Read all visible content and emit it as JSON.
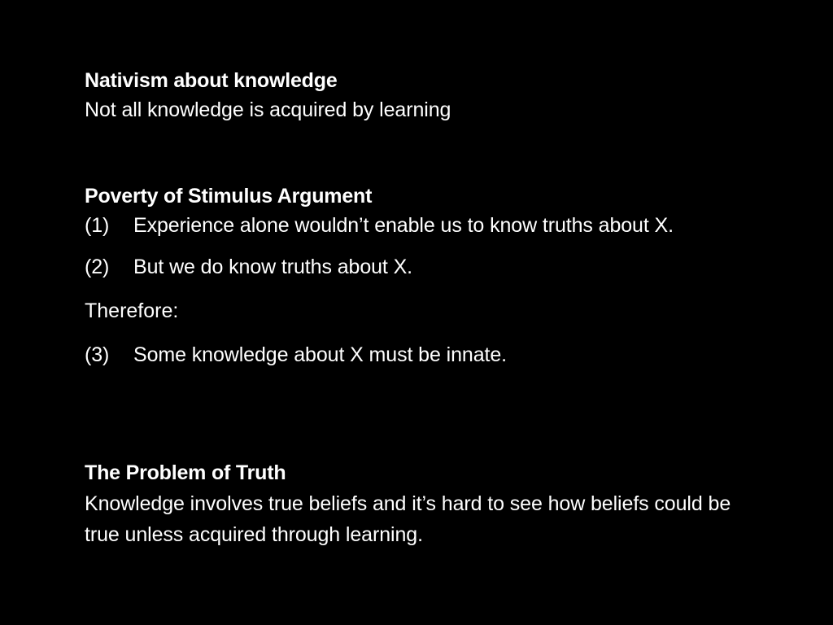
{
  "slide": {
    "background_color": "#000000",
    "text_color": "#ffffff",
    "nativism": {
      "heading": "Nativism about knowledge",
      "text": "Not all knowledge is acquired by learning"
    },
    "poverty": {
      "heading": "Poverty of Stimulus Argument",
      "items": [
        {
          "num": "(1)",
          "text": "Experience alone wouldn’t enable us to know truths about X."
        },
        {
          "num": "(2)",
          "text": "But we do know truths about X."
        }
      ],
      "therefore": "Therefore:",
      "conclusion": {
        "num": "(3)",
        "text": "Some knowledge about X must be innate."
      }
    },
    "truth": {
      "heading": "The Problem of Truth",
      "text": "Knowledge involves true beliefs and it’s hard to see how beliefs could be true unless acquired through learning."
    }
  }
}
